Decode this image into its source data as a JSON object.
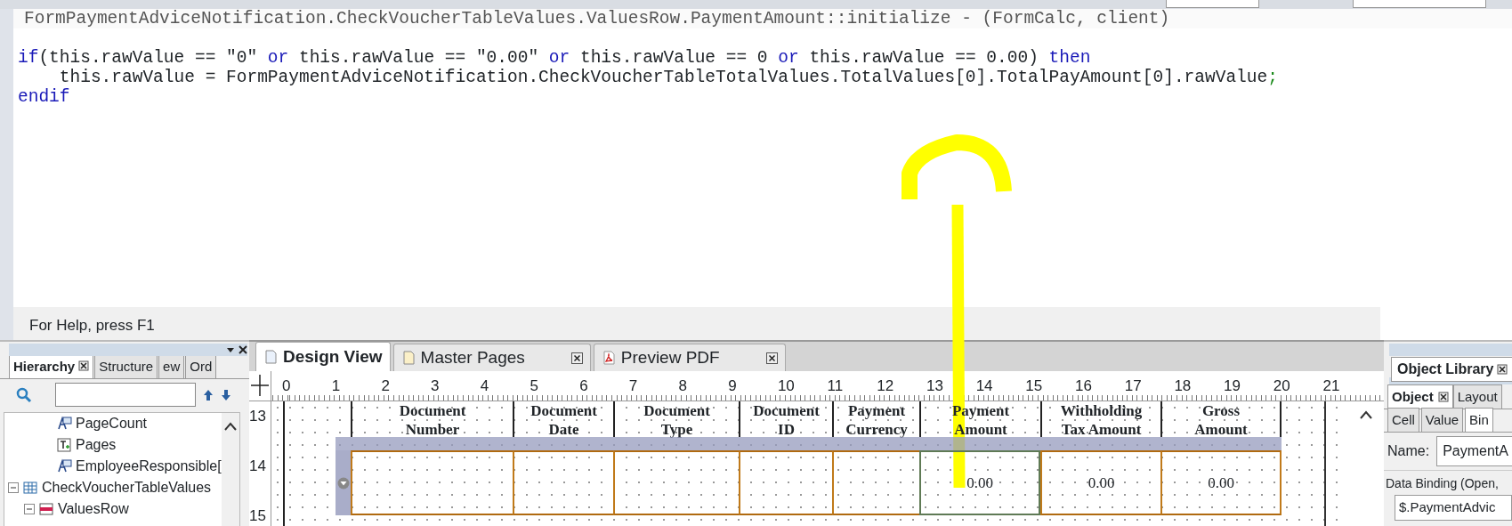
{
  "code_editor": {
    "header": "FormPaymentAdviceNotification.CheckVoucherTableValues.ValuesRow.PaymentAmount::initialize - (FormCalc, client)",
    "lines": [
      [
        {
          "text": "if",
          "kind": "keyword"
        },
        {
          "text": "(this.rawValue == \"0\" ",
          "kind": "plain"
        },
        {
          "text": "or",
          "kind": "keyword"
        },
        {
          "text": " this.rawValue == \"0.00\" ",
          "kind": "plain"
        },
        {
          "text": "or",
          "kind": "keyword"
        },
        {
          "text": " this.rawValue == 0 ",
          "kind": "plain"
        },
        {
          "text": "or",
          "kind": "keyword"
        },
        {
          "text": " this.rawValue == 0.00) ",
          "kind": "plain"
        },
        {
          "text": "then",
          "kind": "keyword"
        }
      ],
      [
        {
          "text": "    this.rawValue = FormPaymentAdviceNotification.CheckVoucherTableTotalValues.TotalValues[0].TotalPayAmount[0].rawValue",
          "kind": "plain"
        },
        {
          "text": ";",
          "kind": "terminator"
        }
      ],
      [
        {
          "text": "endif",
          "kind": "keyword"
        }
      ]
    ]
  },
  "status_bar": "For Help, press F1",
  "hierarchy_panel": {
    "tabs": [
      {
        "label": "Hierarchy",
        "selected": true
      },
      {
        "label": "Structure",
        "selected": false
      },
      {
        "label": "ew",
        "selected": false
      },
      {
        "label": "Ord",
        "selected": false
      }
    ],
    "upper_items": [
      {
        "label": "PageCount",
        "kind": "field"
      },
      {
        "label": "Pages",
        "kind": "text"
      },
      {
        "label": "EmployeeResponsible[",
        "kind": "field"
      }
    ],
    "tree": [
      {
        "label": "CheckVoucherTableValues",
        "kind": "table",
        "expanded": true,
        "children": [
          {
            "label": "ValuesRow",
            "kind": "row",
            "expanded": true
          }
        ]
      }
    ]
  },
  "design_tabs": [
    {
      "label": "Design View",
      "kind": "page",
      "selected": true,
      "closable": false
    },
    {
      "label": "Master Pages",
      "kind": "page",
      "selected": false,
      "closable": true
    },
    {
      "label": "Preview PDF",
      "kind": "pdf",
      "selected": false,
      "closable": true
    }
  ],
  "ruler": {
    "horizontal": [
      "0",
      "1",
      "2",
      "3",
      "4",
      "5",
      "6",
      "7",
      "8",
      "9",
      "10",
      "11",
      "12",
      "13",
      "14",
      "15",
      "16",
      "17",
      "18",
      "19",
      "20",
      "21"
    ],
    "vertical": [
      "13",
      "14",
      "15"
    ]
  },
  "table": {
    "columns": [
      {
        "lines": [
          "Document",
          "Number"
        ]
      },
      {
        "lines": [
          "Document",
          "Date"
        ]
      },
      {
        "lines": [
          "Document",
          "Type"
        ]
      },
      {
        "lines": [
          "Document",
          "ID"
        ]
      },
      {
        "lines": [
          "Payment",
          "Currency"
        ]
      },
      {
        "lines": [
          "Payment",
          "Amount"
        ]
      },
      {
        "lines": [
          "Withholding",
          "Tax Amount"
        ]
      },
      {
        "lines": [
          "Gross",
          "Amount"
        ]
      }
    ],
    "rows": [
      {
        "cells": [
          {
            "selected": false
          },
          {
            "selected": false
          },
          {
            "selected": false
          },
          {
            "selected": false
          },
          {
            "selected": false
          },
          {
            "text": "0.00",
            "selected": true
          },
          {
            "text": "0.00",
            "selected": false
          },
          {
            "text": "0.00",
            "selected": false
          }
        ]
      }
    ]
  },
  "object_library": {
    "title": "Object Library"
  },
  "object_panel": {
    "tabs": [
      {
        "label": "Object",
        "selected": true
      },
      {
        "label": "Layout",
        "selected": false
      }
    ],
    "subtabs": [
      {
        "label": "Cell",
        "selected": false
      },
      {
        "label": "Value",
        "selected": false
      },
      {
        "label": "Bin",
        "selected": true
      }
    ],
    "name_label": "Name:",
    "name_value": "PaymentA",
    "binding_label": "Data Binding (Open,",
    "binding_value": "$.PaymentAdvic"
  }
}
